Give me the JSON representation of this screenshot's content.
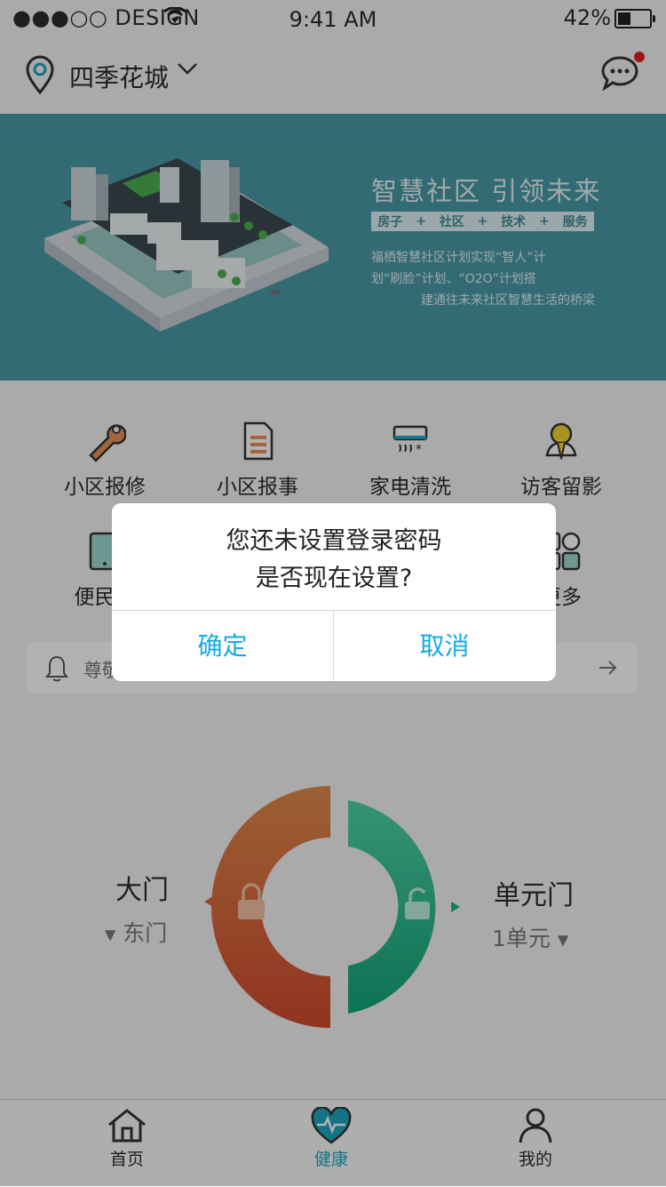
{
  "status_bar": {
    "carrier": "●●●○○ DESIGN",
    "time": "9:41 AM",
    "battery": "42%",
    "battery_level": 0.42
  },
  "header": {
    "location": "四季花城",
    "location_icon": "location-pin-icon",
    "message_icon": "chat-bubble-icon",
    "has_unread": true
  },
  "banner": {
    "headline": "智慧社区  引领未来",
    "tags": [
      "房子",
      "+",
      "社区",
      "+",
      "技术",
      "+",
      "服务"
    ],
    "desc_lines": [
      "福栖智慧社区计划实现“智人”计",
      "划“刷脸”计划、“O2O”计划搭",
      "建通往未来社区智慧生活的桥梁"
    ]
  },
  "services": [
    {
      "label": "小区报修",
      "icon": "wrench-icon"
    },
    {
      "label": "小区报事",
      "icon": "document-icon"
    },
    {
      "label": "家电清洗",
      "icon": "air-conditioner-icon"
    },
    {
      "label": "访客留影",
      "icon": "visitor-icon"
    },
    {
      "label": "便民电",
      "icon": "tablet-icon"
    },
    {
      "label": "更多",
      "icon": "grid-more-icon"
    }
  ],
  "notice": {
    "text": "尊敬"
  },
  "doors": {
    "left": {
      "name": "大门",
      "sub": "东门"
    },
    "right": {
      "name": "单元门",
      "sub": "1单元"
    }
  },
  "tabs": [
    {
      "label": "首页",
      "icon": "home-icon"
    },
    {
      "label": "健康",
      "icon": "heart-pulse-icon",
      "active": true
    },
    {
      "label": "我的",
      "icon": "person-icon"
    }
  ],
  "dialog": {
    "line1": "您还未设置登录密码",
    "line2": "是否现在设置?",
    "confirm": "确定",
    "cancel": "取消"
  },
  "colors": {
    "accent": "#16a9e0",
    "banner": "#4a9aa6",
    "lock_left": "#d9693a",
    "lock_right": "#1fb98a",
    "tab_active": "#1ea5bf"
  }
}
